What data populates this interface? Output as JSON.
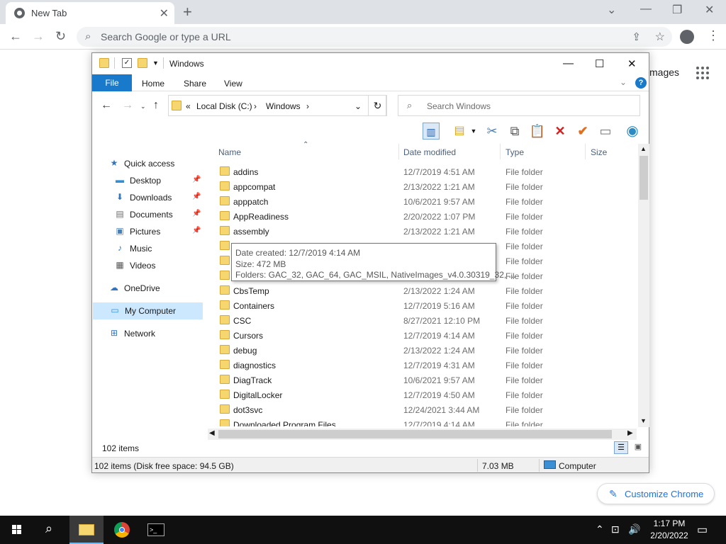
{
  "chrome": {
    "tab_title": "New Tab",
    "omnibox_placeholder": "Search Google or type a URL",
    "images_link": "mages",
    "customize_label": "Customize Chrome"
  },
  "explorer": {
    "title": "Windows",
    "ribbon_tabs": [
      "File",
      "Home",
      "Share",
      "View"
    ],
    "address": {
      "prefix": "«",
      "parts": [
        "Local Disk (C:)",
        "Windows"
      ]
    },
    "search_placeholder": "Search Windows",
    "nav": [
      {
        "label": "Quick access",
        "icon": "star-icon"
      },
      {
        "label": "Desktop",
        "icon": "desktop-icon",
        "pinned": true
      },
      {
        "label": "Downloads",
        "icon": "download-icon",
        "pinned": true
      },
      {
        "label": "Documents",
        "icon": "documents-icon",
        "pinned": true
      },
      {
        "label": "Pictures",
        "icon": "pictures-icon",
        "pinned": true
      },
      {
        "label": "Music",
        "icon": "music-icon"
      },
      {
        "label": "Videos",
        "icon": "videos-icon"
      },
      {
        "label": "OneDrive",
        "icon": "cloud-icon"
      },
      {
        "label": "My Computer",
        "icon": "computer-icon",
        "selected": true
      },
      {
        "label": "Network",
        "icon": "network-icon"
      }
    ],
    "columns": [
      "Name",
      "Date modified",
      "Type",
      "Size"
    ],
    "rows": [
      {
        "name": "addins",
        "date": "12/7/2019 4:51 AM",
        "type": "File folder"
      },
      {
        "name": "appcompat",
        "date": "2/13/2022 1:21 AM",
        "type": "File folder"
      },
      {
        "name": "apppatch",
        "date": "10/6/2021 9:57 AM",
        "type": "File folder"
      },
      {
        "name": "AppReadiness",
        "date": "2/20/2022 1:07 PM",
        "type": "File folder"
      },
      {
        "name": "assembly",
        "date": "2/13/2022 1:21 AM",
        "type": "File folder"
      },
      {
        "name": "",
        "date": "",
        "type": "File folder"
      },
      {
        "name": "",
        "date": "",
        "type": "File folder"
      },
      {
        "name": "",
        "date": "",
        "type": "File folder"
      },
      {
        "name": "CbsTemp",
        "date": "2/13/2022 1:24 AM",
        "type": "File folder"
      },
      {
        "name": "Containers",
        "date": "12/7/2019 5:16 AM",
        "type": "File folder"
      },
      {
        "name": "CSC",
        "date": "8/27/2021 12:10 PM",
        "type": "File folder"
      },
      {
        "name": "Cursors",
        "date": "12/7/2019 4:14 AM",
        "type": "File folder"
      },
      {
        "name": "debug",
        "date": "2/13/2022 1:24 AM",
        "type": "File folder"
      },
      {
        "name": "diagnostics",
        "date": "12/7/2019 4:31 AM",
        "type": "File folder"
      },
      {
        "name": "DiagTrack",
        "date": "10/6/2021 9:57 AM",
        "type": "File folder"
      },
      {
        "name": "DigitalLocker",
        "date": "12/7/2019 4:50 AM",
        "type": "File folder"
      },
      {
        "name": "dot3svc",
        "date": "12/24/2021 3:44 AM",
        "type": "File folder"
      },
      {
        "name": "Downloaded Program Files",
        "date": "12/7/2019 4:14 AM",
        "type": "File folder"
      }
    ],
    "tooltip": {
      "created": "Date created: 12/7/2019 4:14 AM",
      "size": "Size: 472 MB",
      "folders": "Folders: GAC_32, GAC_64, GAC_MSIL, NativeImages_v4.0.30319_32, ..."
    },
    "item_count": "102 items",
    "status": {
      "left": "102 items (Disk free space: 94.5 GB)",
      "size": "7.03 MB",
      "location": "Computer"
    }
  },
  "taskbar": {
    "time": "1:17 PM",
    "date": "2/20/2022"
  }
}
